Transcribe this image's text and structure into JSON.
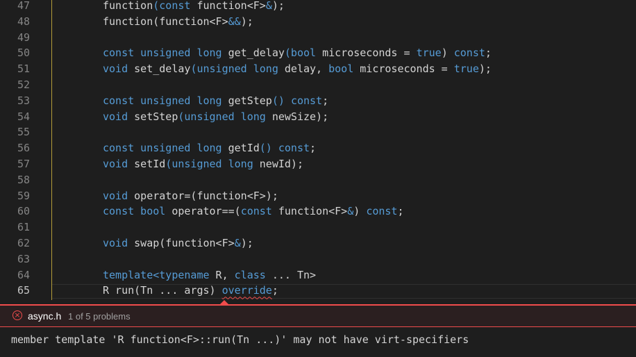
{
  "editor": {
    "active_line": "65",
    "lines": [
      {
        "n": "47",
        "parts": [
          [
            "p",
            "function"
          ],
          [
            "k",
            "("
          ],
          [
            "k",
            "const"
          ],
          [
            "p",
            " function<F>"
          ],
          [
            "k",
            "&"
          ],
          [
            "p",
            ");"
          ]
        ]
      },
      {
        "n": "48",
        "parts": [
          [
            "p",
            "function(function<F>"
          ],
          [
            "k",
            "&&"
          ],
          [
            "p",
            ");"
          ]
        ]
      },
      {
        "n": "49",
        "parts": []
      },
      {
        "n": "50",
        "parts": [
          [
            "k",
            "const unsigned long"
          ],
          [
            "p",
            " get_delay"
          ],
          [
            "k",
            "(bool"
          ],
          [
            "p",
            " microseconds = "
          ],
          [
            "k",
            "true"
          ],
          [
            "p",
            ") "
          ],
          [
            "k",
            "const"
          ],
          [
            "p",
            ";"
          ]
        ]
      },
      {
        "n": "51",
        "parts": [
          [
            "k",
            "void"
          ],
          [
            "p",
            " set_delay"
          ],
          [
            "k",
            "(unsigned long"
          ],
          [
            "p",
            " delay, "
          ],
          [
            "k",
            "bool"
          ],
          [
            "p",
            " microseconds = "
          ],
          [
            "k",
            "true"
          ],
          [
            "p",
            ");"
          ]
        ]
      },
      {
        "n": "52",
        "parts": []
      },
      {
        "n": "53",
        "parts": [
          [
            "k",
            "const unsigned long"
          ],
          [
            "p",
            " getStep"
          ],
          [
            "k",
            "()"
          ],
          [
            "p",
            " "
          ],
          [
            "k",
            "const"
          ],
          [
            "p",
            ";"
          ]
        ]
      },
      {
        "n": "54",
        "parts": [
          [
            "k",
            "void"
          ],
          [
            "p",
            " setStep"
          ],
          [
            "k",
            "(unsigned long"
          ],
          [
            "p",
            " newSize);"
          ]
        ]
      },
      {
        "n": "55",
        "parts": []
      },
      {
        "n": "56",
        "parts": [
          [
            "k",
            "const unsigned long"
          ],
          [
            "p",
            " getId"
          ],
          [
            "k",
            "()"
          ],
          [
            "p",
            " "
          ],
          [
            "k",
            "const"
          ],
          [
            "p",
            ";"
          ]
        ]
      },
      {
        "n": "57",
        "parts": [
          [
            "k",
            "void"
          ],
          [
            "p",
            " setId"
          ],
          [
            "k",
            "(unsigned long"
          ],
          [
            "p",
            " newId);"
          ]
        ]
      },
      {
        "n": "58",
        "parts": []
      },
      {
        "n": "59",
        "parts": [
          [
            "k",
            "void"
          ],
          [
            "p",
            " operator=(function<F>);"
          ]
        ]
      },
      {
        "n": "60",
        "parts": [
          [
            "k",
            "const bool"
          ],
          [
            "p",
            " operator==("
          ],
          [
            "k",
            "const"
          ],
          [
            "p",
            " function<F>"
          ],
          [
            "k",
            "&"
          ],
          [
            "p",
            ") "
          ],
          [
            "k",
            "const"
          ],
          [
            "p",
            ";"
          ]
        ]
      },
      {
        "n": "61",
        "parts": []
      },
      {
        "n": "62",
        "parts": [
          [
            "k",
            "void"
          ],
          [
            "p",
            " swap(function<F>"
          ],
          [
            "k",
            "&"
          ],
          [
            "p",
            ");"
          ]
        ]
      },
      {
        "n": "63",
        "parts": []
      },
      {
        "n": "64",
        "parts": [
          [
            "k",
            "template<typename"
          ],
          [
            "p",
            " R, "
          ],
          [
            "k",
            "class"
          ],
          [
            "p",
            " ... Tn>"
          ]
        ]
      },
      {
        "n": "65",
        "parts": [
          [
            "p",
            "R run(Tn ... args) "
          ],
          [
            "s",
            "override"
          ],
          [
            "p",
            ";"
          ]
        ]
      }
    ]
  },
  "peek": {
    "file": "async.h",
    "count": "1 of 5 problems",
    "message": "member template 'R function<F>::run(Tn ...)' may not have virt-specifiers",
    "icon": "error-circle-icon",
    "accent_color": "#f14c4c"
  }
}
